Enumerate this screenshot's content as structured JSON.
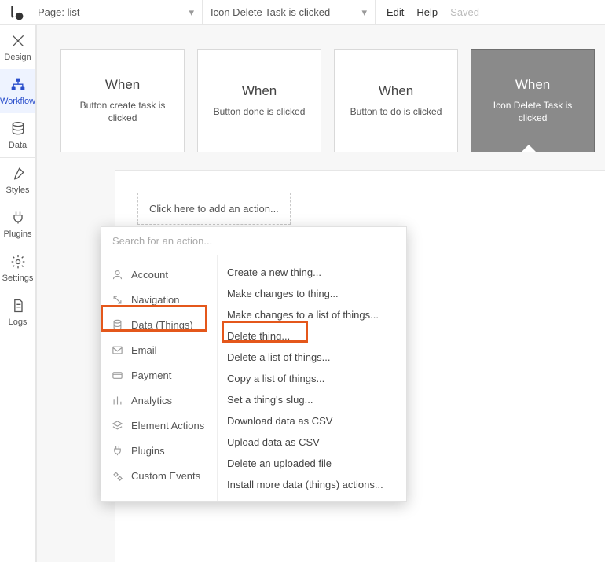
{
  "topbar": {
    "page_label": "Page: list",
    "event_label": "Icon Delete Task is clicked",
    "menu": {
      "edit": "Edit",
      "help": "Help",
      "saved": "Saved"
    }
  },
  "left_rail": [
    {
      "id": "design",
      "label": "Design"
    },
    {
      "id": "workflow",
      "label": "Workflow"
    },
    {
      "id": "data",
      "label": "Data"
    },
    {
      "id": "styles",
      "label": "Styles"
    },
    {
      "id": "plugins",
      "label": "Plugins"
    },
    {
      "id": "settings",
      "label": "Settings"
    },
    {
      "id": "logs",
      "label": "Logs"
    }
  ],
  "events": [
    {
      "title": "When",
      "desc": "Button create task is clicked"
    },
    {
      "title": "When",
      "desc": "Button done is clicked"
    },
    {
      "title": "When",
      "desc": "Button to do is clicked"
    },
    {
      "title": "When",
      "desc": "Icon Delete Task is clicked"
    }
  ],
  "add_action_label": "Click here to add an action...",
  "search_placeholder": "Search for an action...",
  "categories": [
    "Account",
    "Navigation",
    "Data (Things)",
    "Email",
    "Payment",
    "Analytics",
    "Element Actions",
    "Plugins",
    "Custom Events"
  ],
  "actions": [
    "Create a new thing...",
    "Make changes to thing...",
    "Make changes to a list of things...",
    "Delete thing...",
    "Delete a list of things...",
    "Copy a list of things...",
    "Set a thing's slug...",
    "Download data as CSV",
    "Upload data as CSV",
    "Delete an uploaded file",
    "Install more data (things) actions..."
  ],
  "highlights": {
    "category": "Data (Things)",
    "action": "Delete thing..."
  }
}
